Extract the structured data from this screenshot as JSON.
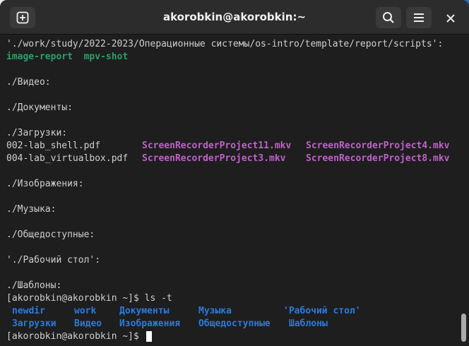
{
  "window": {
    "title": "akorobkin@akorobkin:~"
  },
  "terminal": {
    "scripts_header": "'./work/study/2022-2023/Операционные системы/os-intro/template/report/scripts':",
    "scripts_files": [
      "image-report",
      "mpv-shot"
    ],
    "video_header": "./Видео:",
    "docs_header": "./Документы:",
    "downloads_header": "./Загрузки:",
    "downloads_row1": [
      "002-lab_shell.pdf",
      "ScreenRecorderProject11.mkv",
      "ScreenRecorderProject4.mkv"
    ],
    "downloads_row2": [
      "004-lab_virtualbox.pdf",
      "ScreenRecorderProject3.mkv",
      "ScreenRecorderProject8.mkv"
    ],
    "images_header": "./Изображения:",
    "music_header": "./Музыка:",
    "public_header": "./Общедоступные:",
    "desktop_header": "'./Рабочий стол':",
    "templates_header": "./Шаблоны:",
    "prompt": "[akorobkin@akorobkin ~]$",
    "command": " ls -t",
    "ls_row1": [
      "newdir",
      "work",
      "Документы",
      "Музыка",
      "'Рабочий стол'"
    ],
    "ls_row2": [
      "Загрузки",
      "Видео",
      "Изображения",
      "Общедоступные",
      "Шаблоны"
    ]
  },
  "icons": {
    "new_tab": "plus-square-icon",
    "search": "search-icon",
    "menu": "hamburger-menu-icon",
    "close": "close-icon"
  },
  "colors": {
    "background": "#1e1e1e",
    "text": "#d0d0d0",
    "executable": "#26a269",
    "media": "#c061cb",
    "directory": "#2a7bde"
  }
}
